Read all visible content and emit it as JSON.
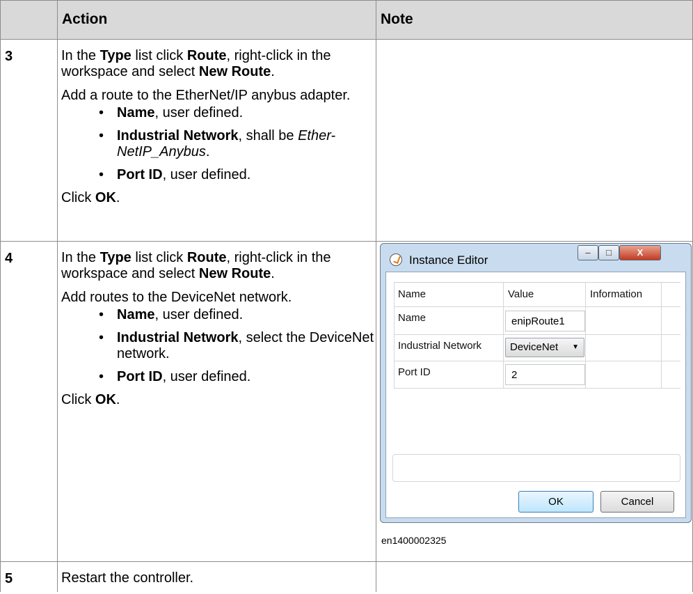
{
  "header": {
    "col1": "",
    "col2": "Action",
    "col3": "Note"
  },
  "steps": [
    {
      "number": "3",
      "p1": {
        "t1": "In the ",
        "b1": "Type",
        "t2": " list click ",
        "b2": "Route",
        "t3": ", right-click in the workspace and select ",
        "b3": "New Route",
        "t4": "."
      },
      "p2": "Add a route to the EtherNet/IP anybus adapter.",
      "bullets": [
        {
          "bold": "Name",
          "text": ", user defined."
        },
        {
          "bold": "Industrial Network",
          "text": ", shall be ",
          "italic": "Ether-NetIP_Anybus",
          "end": "."
        },
        {
          "bold": "Port ID",
          "text": ", user defined."
        }
      ],
      "click": {
        "t": "Click ",
        "b": "OK",
        "end": "."
      }
    },
    {
      "number": "4",
      "p1": {
        "t1": "In the ",
        "b1": "Type",
        "t2": " list click ",
        "b2": "Route",
        "t3": ", right-click in the workspace and select ",
        "b3": "New Route",
        "t4": "."
      },
      "p2": "Add routes to the DeviceNet network.",
      "bullets": [
        {
          "bold": "Name",
          "text": ", user defined."
        },
        {
          "bold": "Industrial Network",
          "text": ", select the DeviceNet network."
        },
        {
          "bold": "Port ID",
          "text": ", user defined."
        }
      ],
      "click": {
        "t": "Click ",
        "b": "OK",
        "end": "."
      }
    },
    {
      "number": "5",
      "text": "Restart the controller."
    }
  ],
  "bullet_glyph": "•",
  "dialog": {
    "title": "Instance Editor",
    "window_buttons": {
      "minimize": "–",
      "maximize": "□",
      "close": "X"
    },
    "columns": [
      "Name",
      "Value",
      "Information"
    ],
    "rows": [
      {
        "name": "Name",
        "value": "enipRoute1"
      },
      {
        "name": "Industrial Network",
        "value": "DeviceNet",
        "arrow": "▼"
      },
      {
        "name": "Port ID",
        "value": "2"
      }
    ],
    "ok": "OK",
    "cancel": "Cancel"
  },
  "caption": "en1400002325"
}
